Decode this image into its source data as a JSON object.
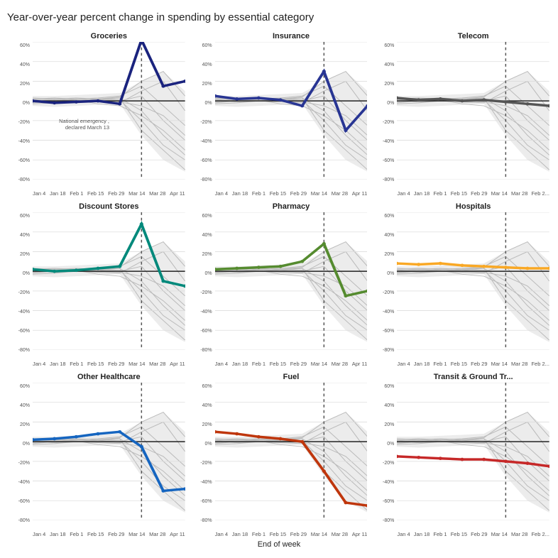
{
  "title": "Year-over-year percent change in spending by essential category",
  "end_label": "End of week",
  "x_labels": [
    "Jan 4",
    "Jan 18",
    "Feb 1",
    "Feb 15",
    "Feb 29",
    "Mar 14",
    "Mar 28",
    "Apr 11"
  ],
  "y_labels": [
    "60%",
    "40%",
    "20%",
    "0%",
    "-20%",
    "-40%",
    "-60%",
    "-80%"
  ],
  "emergency_text1": "National emergency ,",
  "emergency_text2": "declared March 13",
  "charts": [
    {
      "id": "groceries",
      "title": "Groceries",
      "color": "#1a237e",
      "show_emergency": true,
      "emergency_pos": 0.68
    },
    {
      "id": "insurance",
      "title": "Insurance",
      "color": "#283593",
      "show_emergency": true,
      "emergency_pos": 0.68
    },
    {
      "id": "telecom",
      "title": "Telecom",
      "color": "#555555",
      "show_emergency": false,
      "emergency_pos": 0.68
    },
    {
      "id": "discount-stores",
      "title": "Discount Stores",
      "color": "#00897b",
      "show_emergency": true,
      "emergency_pos": 0.68
    },
    {
      "id": "pharmacy",
      "title": "Pharmacy",
      "color": "#558b2f",
      "show_emergency": true,
      "emergency_pos": 0.68
    },
    {
      "id": "hospitals",
      "title": "Hospitals",
      "color": "#f9a825",
      "show_emergency": false,
      "emergency_pos": 0.68
    },
    {
      "id": "other-healthcare",
      "title": "Other Healthcare",
      "color": "#1565c0",
      "show_emergency": true,
      "emergency_pos": 0.68
    },
    {
      "id": "fuel",
      "title": "Fuel",
      "color": "#bf360c",
      "show_emergency": true,
      "emergency_pos": 0.68
    },
    {
      "id": "transit",
      "title": "Transit & Ground Tr...",
      "color": "#c62828",
      "show_emergency": false,
      "emergency_pos": 0.68
    }
  ]
}
